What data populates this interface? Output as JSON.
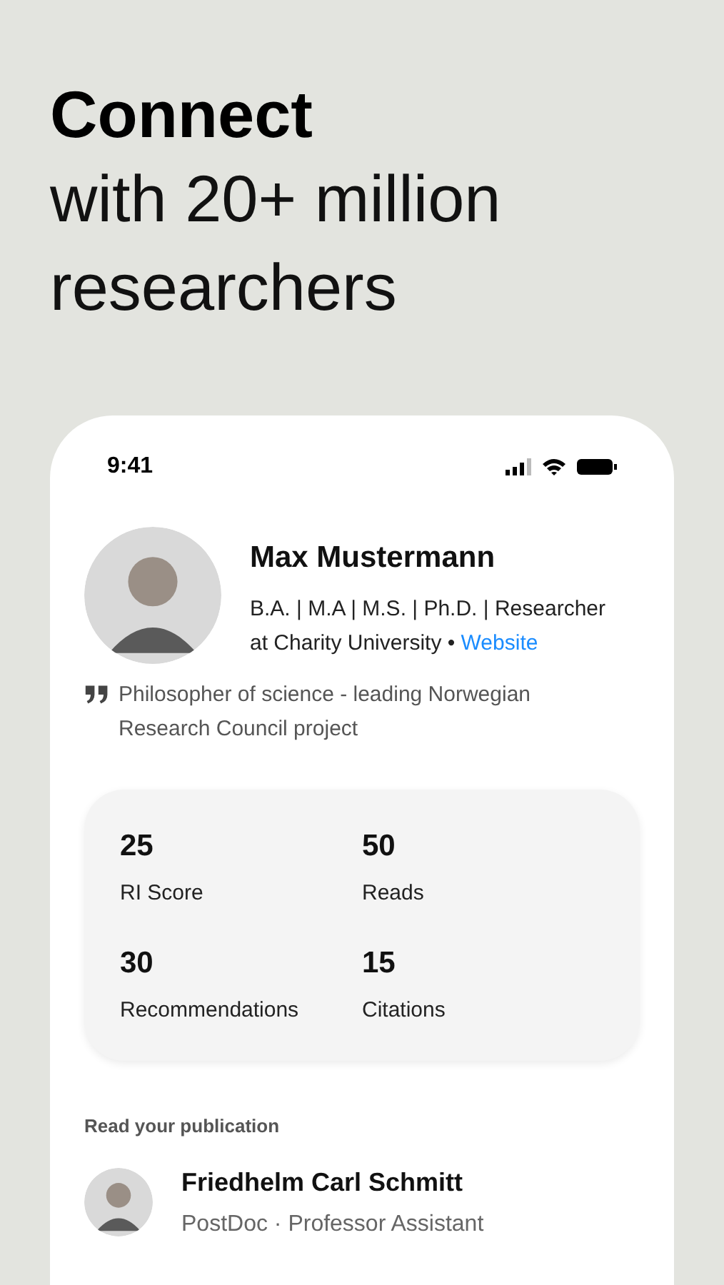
{
  "headline": {
    "title": "Connect",
    "subtitle": "with 20+ million researchers"
  },
  "phone": {
    "status_bar": {
      "time": "9:41"
    },
    "profile": {
      "name": "Max Mustermann",
      "headline": "B.A. | M.A | M.S. | Ph.D. | Researcher at Charity University • ",
      "link": "Website",
      "quote": "Philosopher of science - leading Norwegian Research Council project"
    },
    "stats": [
      {
        "value": "25",
        "label": "RI Score"
      },
      {
        "value": "50",
        "label": "Reads"
      },
      {
        "value": "30",
        "label": "Recommendations"
      },
      {
        "value": "15",
        "label": "Citations"
      }
    ],
    "publication": {
      "section_title": "Read your publication",
      "author": "Friedhelm Carl Schmitt",
      "role": "PostDoc · Professor Assistant"
    }
  }
}
